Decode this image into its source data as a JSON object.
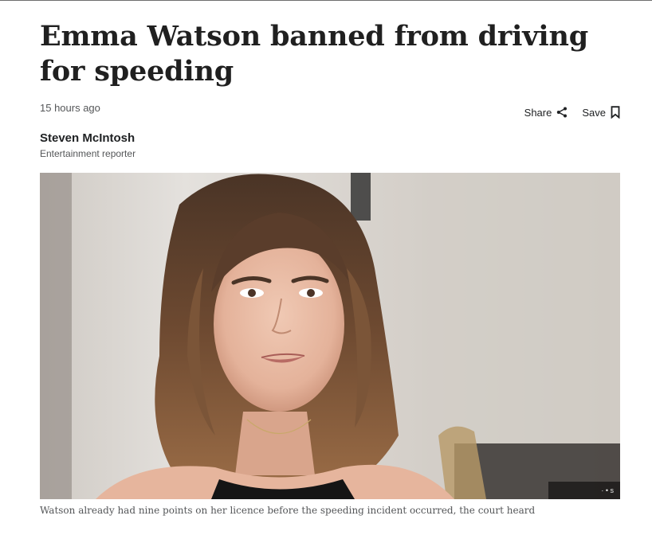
{
  "article": {
    "headline": "Emma Watson banned from driving for speeding",
    "timestamp": "15 hours ago",
    "author_name": "Steven McIntosh",
    "author_role": "Entertainment reporter",
    "caption": "Watson already had nine points on her licence before the speeding incident occurred, the court heard",
    "image_credit": "· • s"
  },
  "actions": {
    "share_label": "Share",
    "save_label": "Save"
  },
  "icons": {
    "share": "share-icon",
    "save": "bookmark-icon"
  }
}
